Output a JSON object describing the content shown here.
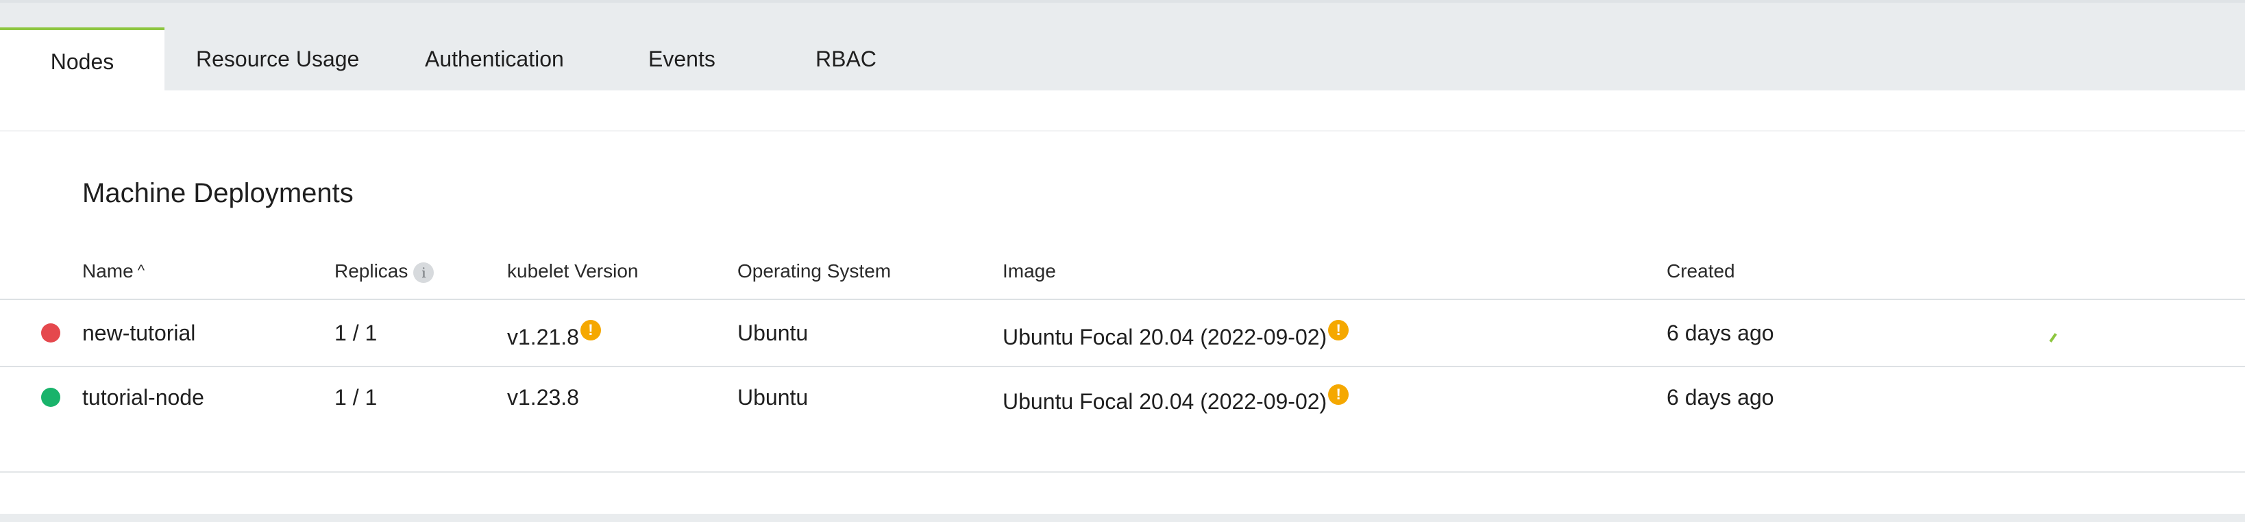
{
  "tabs": [
    {
      "label": "Nodes",
      "active": true
    },
    {
      "label": "Resource Usage"
    },
    {
      "label": "Authentication"
    },
    {
      "label": "Events"
    },
    {
      "label": "RBAC"
    }
  ],
  "section": {
    "title": "Machine Deployments"
  },
  "table": {
    "headers": {
      "name": "Name",
      "replicas": "Replicas",
      "kubelet": "kubelet Version",
      "os": "Operating System",
      "image": "Image",
      "created": "Created"
    },
    "sort_indicator": "^",
    "info_glyph": "i",
    "warning_glyph": "!",
    "rows": [
      {
        "status": "error",
        "status_color": "#e5484d",
        "name": "new-tutorial",
        "replicas": "1 / 1",
        "kubelet": "v1.21.8",
        "kubelet_warning": true,
        "os": "Ubuntu",
        "image": "Ubuntu Focal 20.04 (2022-09-02)",
        "image_warning": true,
        "created": "6 days ago"
      },
      {
        "status": "running",
        "status_color": "#19b36b",
        "name": "tutorial-node",
        "replicas": "1 / 1",
        "kubelet": "v1.23.8",
        "kubelet_warning": false,
        "os": "Ubuntu",
        "image": "Ubuntu Focal 20.04 (2022-09-02)",
        "image_warning": true,
        "created": "6 days ago"
      }
    ]
  },
  "colors": {
    "accent": "#8dc63f",
    "warning": "#f5a800",
    "background": "#e9ecee"
  }
}
